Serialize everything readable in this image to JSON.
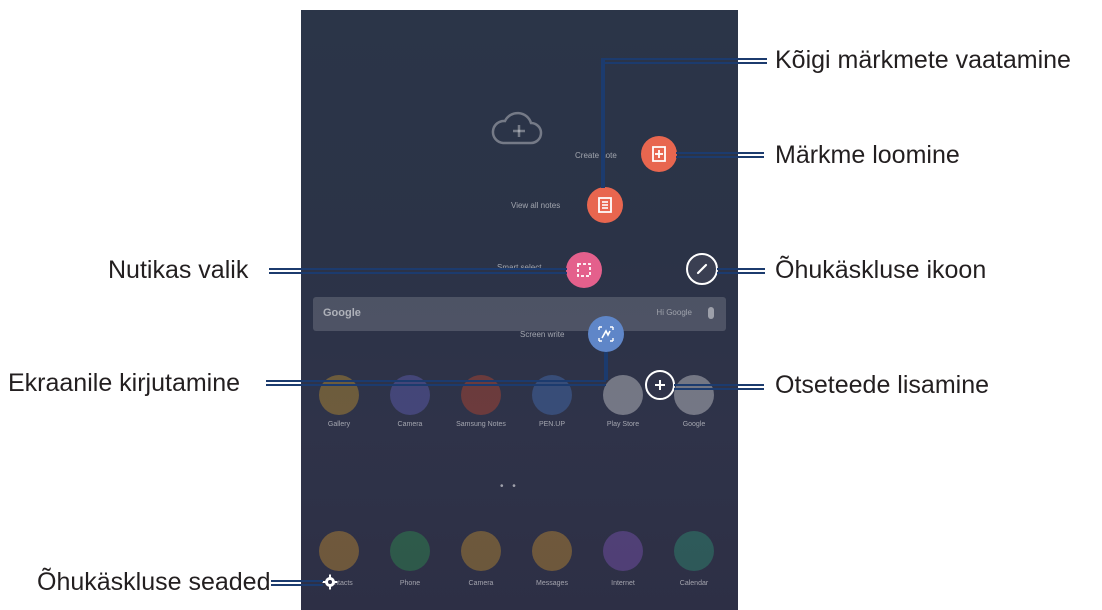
{
  "callouts": {
    "view_all_notes": "Kõigi märkmete vaatamine",
    "create_note": "Märkme loomine",
    "smart_select": "Nutikas valik",
    "air_command_icon": "Õhukäskluse ikoon",
    "screen_write": "Ekraanile kirjutamine",
    "add_shortcuts": "Otseteede lisamine",
    "air_command_settings": "Õhukäskluse seaded"
  },
  "screen": {
    "menu": {
      "create_note": "Create note",
      "view_all_notes": "View all notes",
      "smart_select": "Smart select",
      "screen_write": "Screen write"
    },
    "search": {
      "logo": "Google",
      "hint": "Hi Google"
    },
    "apps_row1": [
      "Gallery",
      "Camera",
      "Samsung Notes",
      "PEN.UP",
      "Play Store",
      "Google"
    ],
    "apps_row2": [
      "Contacts",
      "Phone",
      "Camera",
      "Messages",
      "Internet",
      "Calendar"
    ]
  },
  "colors": {
    "accent_orange": "#e8664f",
    "accent_pink": "#e4608c",
    "accent_blue": "#5f86c8",
    "leader_line": "#1c3b6e"
  },
  "icons": [
    "cloud-add-icon",
    "create-note-icon",
    "view-notes-icon",
    "smart-select-icon",
    "air-command-pen-icon",
    "screen-write-icon",
    "add-icon",
    "gear-icon"
  ]
}
